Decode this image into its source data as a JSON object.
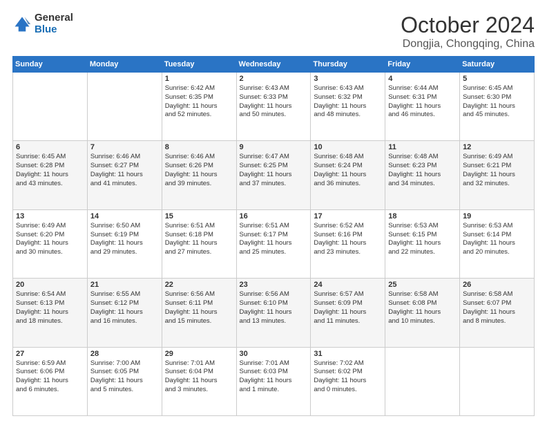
{
  "header": {
    "logo_general": "General",
    "logo_blue": "Blue",
    "month": "October 2024",
    "location": "Dongjia, Chongqing, China"
  },
  "days_of_week": [
    "Sunday",
    "Monday",
    "Tuesday",
    "Wednesday",
    "Thursday",
    "Friday",
    "Saturday"
  ],
  "weeks": [
    [
      {
        "day": "",
        "content": ""
      },
      {
        "day": "",
        "content": ""
      },
      {
        "day": "1",
        "content": "Sunrise: 6:42 AM\nSunset: 6:35 PM\nDaylight: 11 hours\nand 52 minutes."
      },
      {
        "day": "2",
        "content": "Sunrise: 6:43 AM\nSunset: 6:33 PM\nDaylight: 11 hours\nand 50 minutes."
      },
      {
        "day": "3",
        "content": "Sunrise: 6:43 AM\nSunset: 6:32 PM\nDaylight: 11 hours\nand 48 minutes."
      },
      {
        "day": "4",
        "content": "Sunrise: 6:44 AM\nSunset: 6:31 PM\nDaylight: 11 hours\nand 46 minutes."
      },
      {
        "day": "5",
        "content": "Sunrise: 6:45 AM\nSunset: 6:30 PM\nDaylight: 11 hours\nand 45 minutes."
      }
    ],
    [
      {
        "day": "6",
        "content": "Sunrise: 6:45 AM\nSunset: 6:28 PM\nDaylight: 11 hours\nand 43 minutes."
      },
      {
        "day": "7",
        "content": "Sunrise: 6:46 AM\nSunset: 6:27 PM\nDaylight: 11 hours\nand 41 minutes."
      },
      {
        "day": "8",
        "content": "Sunrise: 6:46 AM\nSunset: 6:26 PM\nDaylight: 11 hours\nand 39 minutes."
      },
      {
        "day": "9",
        "content": "Sunrise: 6:47 AM\nSunset: 6:25 PM\nDaylight: 11 hours\nand 37 minutes."
      },
      {
        "day": "10",
        "content": "Sunrise: 6:48 AM\nSunset: 6:24 PM\nDaylight: 11 hours\nand 36 minutes."
      },
      {
        "day": "11",
        "content": "Sunrise: 6:48 AM\nSunset: 6:23 PM\nDaylight: 11 hours\nand 34 minutes."
      },
      {
        "day": "12",
        "content": "Sunrise: 6:49 AM\nSunset: 6:21 PM\nDaylight: 11 hours\nand 32 minutes."
      }
    ],
    [
      {
        "day": "13",
        "content": "Sunrise: 6:49 AM\nSunset: 6:20 PM\nDaylight: 11 hours\nand 30 minutes."
      },
      {
        "day": "14",
        "content": "Sunrise: 6:50 AM\nSunset: 6:19 PM\nDaylight: 11 hours\nand 29 minutes."
      },
      {
        "day": "15",
        "content": "Sunrise: 6:51 AM\nSunset: 6:18 PM\nDaylight: 11 hours\nand 27 minutes."
      },
      {
        "day": "16",
        "content": "Sunrise: 6:51 AM\nSunset: 6:17 PM\nDaylight: 11 hours\nand 25 minutes."
      },
      {
        "day": "17",
        "content": "Sunrise: 6:52 AM\nSunset: 6:16 PM\nDaylight: 11 hours\nand 23 minutes."
      },
      {
        "day": "18",
        "content": "Sunrise: 6:53 AM\nSunset: 6:15 PM\nDaylight: 11 hours\nand 22 minutes."
      },
      {
        "day": "19",
        "content": "Sunrise: 6:53 AM\nSunset: 6:14 PM\nDaylight: 11 hours\nand 20 minutes."
      }
    ],
    [
      {
        "day": "20",
        "content": "Sunrise: 6:54 AM\nSunset: 6:13 PM\nDaylight: 11 hours\nand 18 minutes."
      },
      {
        "day": "21",
        "content": "Sunrise: 6:55 AM\nSunset: 6:12 PM\nDaylight: 11 hours\nand 16 minutes."
      },
      {
        "day": "22",
        "content": "Sunrise: 6:56 AM\nSunset: 6:11 PM\nDaylight: 11 hours\nand 15 minutes."
      },
      {
        "day": "23",
        "content": "Sunrise: 6:56 AM\nSunset: 6:10 PM\nDaylight: 11 hours\nand 13 minutes."
      },
      {
        "day": "24",
        "content": "Sunrise: 6:57 AM\nSunset: 6:09 PM\nDaylight: 11 hours\nand 11 minutes."
      },
      {
        "day": "25",
        "content": "Sunrise: 6:58 AM\nSunset: 6:08 PM\nDaylight: 11 hours\nand 10 minutes."
      },
      {
        "day": "26",
        "content": "Sunrise: 6:58 AM\nSunset: 6:07 PM\nDaylight: 11 hours\nand 8 minutes."
      }
    ],
    [
      {
        "day": "27",
        "content": "Sunrise: 6:59 AM\nSunset: 6:06 PM\nDaylight: 11 hours\nand 6 minutes."
      },
      {
        "day": "28",
        "content": "Sunrise: 7:00 AM\nSunset: 6:05 PM\nDaylight: 11 hours\nand 5 minutes."
      },
      {
        "day": "29",
        "content": "Sunrise: 7:01 AM\nSunset: 6:04 PM\nDaylight: 11 hours\nand 3 minutes."
      },
      {
        "day": "30",
        "content": "Sunrise: 7:01 AM\nSunset: 6:03 PM\nDaylight: 11 hours\nand 1 minute."
      },
      {
        "day": "31",
        "content": "Sunrise: 7:02 AM\nSunset: 6:02 PM\nDaylight: 11 hours\nand 0 minutes."
      },
      {
        "day": "",
        "content": ""
      },
      {
        "day": "",
        "content": ""
      }
    ]
  ]
}
